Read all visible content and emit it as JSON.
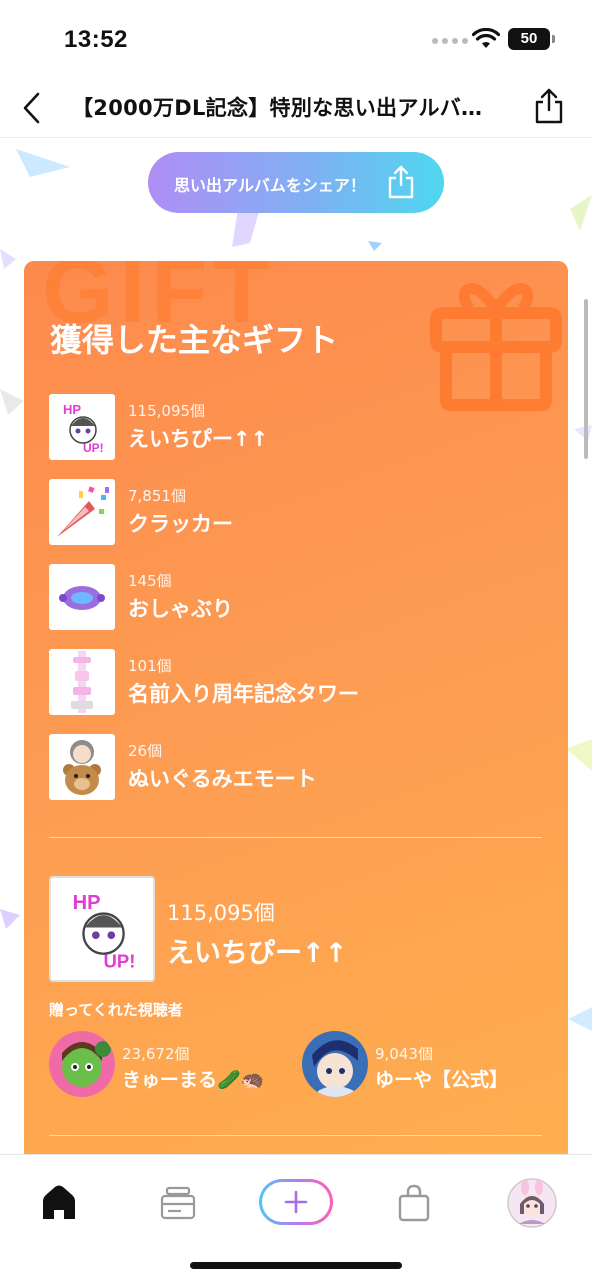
{
  "status_bar": {
    "time": "13:52",
    "battery": "50"
  },
  "nav": {
    "title": "【2000万DL記念】特別な思い出アルバ…"
  },
  "share_pill": {
    "label": "思い出アルバムをシェア！"
  },
  "card": {
    "watermark": "GIFT",
    "heading": "獲得した主なギフト",
    "gifts": [
      {
        "count": "115,095個",
        "name": "えいちぴー↑↑",
        "icon": "hp-up-sticker-icon"
      },
      {
        "count": "7,851個",
        "name": "クラッカー",
        "icon": "party-cracker-icon"
      },
      {
        "count": "145個",
        "name": "おしゃぶり",
        "icon": "pacifier-icon"
      },
      {
        "count": "101個",
        "name": "名前入り周年記念タワー",
        "icon": "anniversary-tower-icon"
      },
      {
        "count": "26個",
        "name": "ぬいぐるみエモート",
        "icon": "plush-emote-icon"
      }
    ],
    "top_gift": {
      "count": "115,095個",
      "name": "えいちぴー↑↑",
      "viewers_label": "贈ってくれた視聴者",
      "viewers": [
        {
          "count": "23,672個",
          "name": "きゅーまる🥒🦔"
        },
        {
          "count": "9,043個",
          "name": "ゆーや【公式】"
        }
      ]
    }
  },
  "tabbar": {
    "items": [
      "home-icon",
      "ticket-icon",
      "add-icon",
      "shop-bag-icon",
      "profile-avatar"
    ]
  },
  "colors": {
    "card_start": "#fd8a4d",
    "card_end": "#ffaf4f",
    "pill_start": "#b08ef5",
    "pill_end": "#4fd7ef"
  }
}
